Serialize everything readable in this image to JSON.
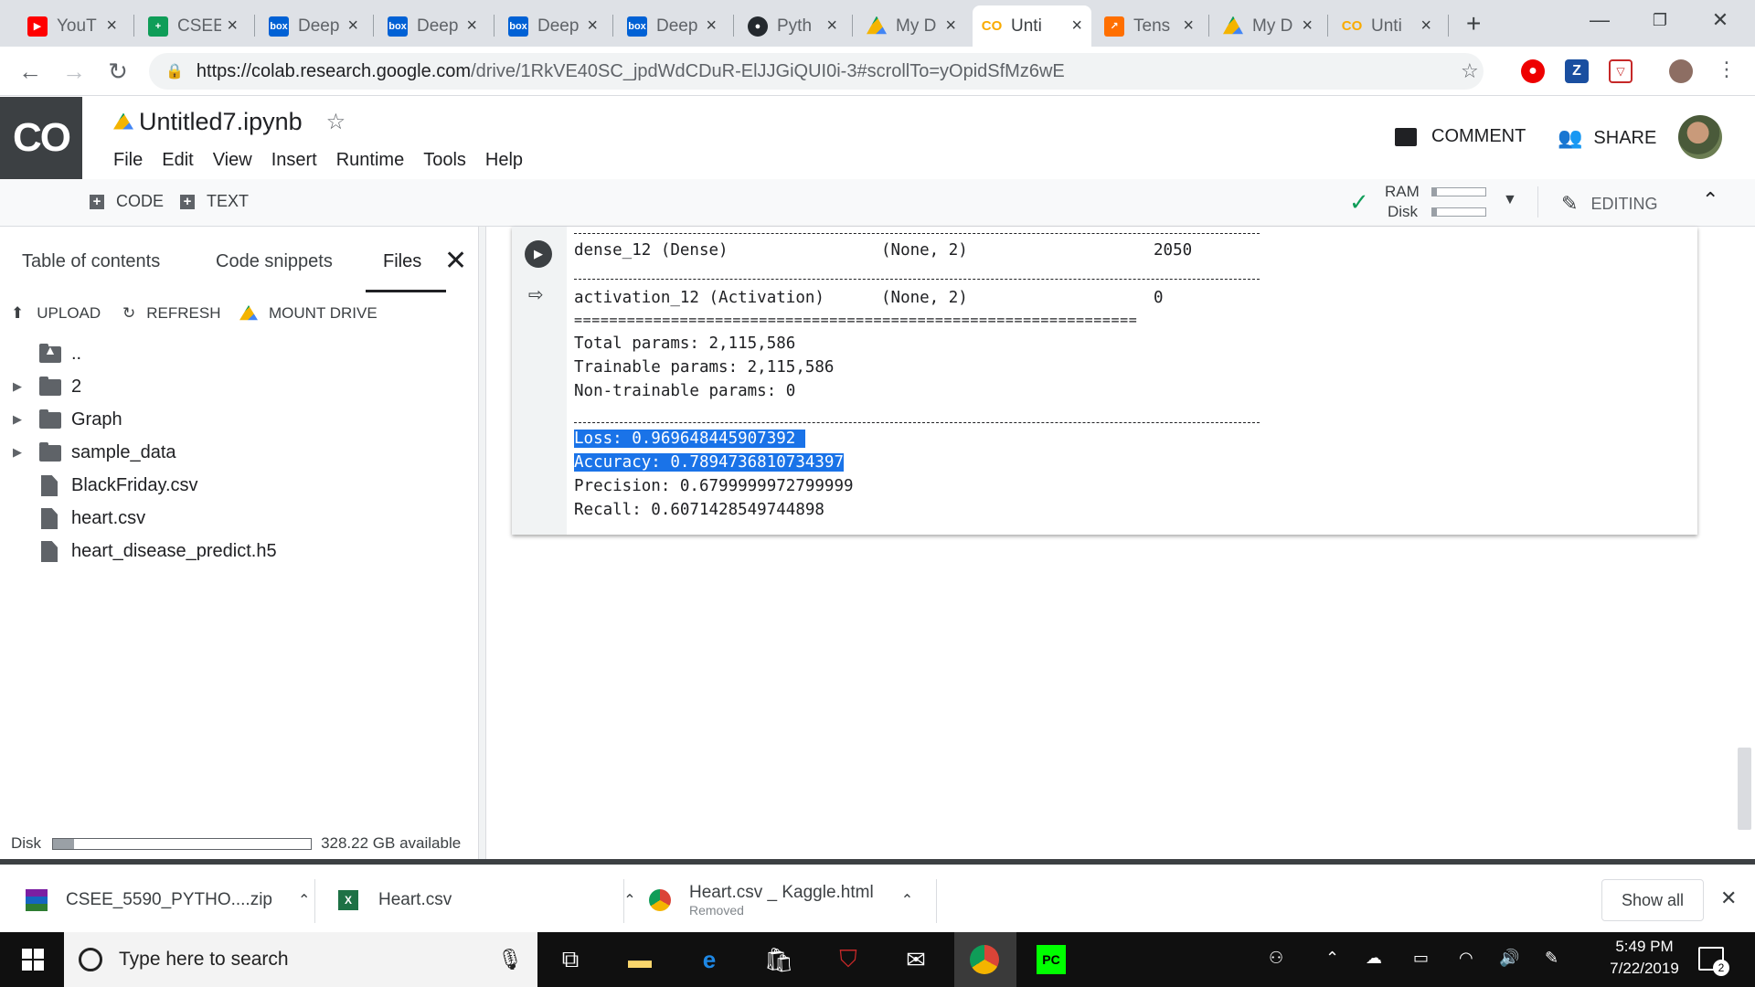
{
  "browser": {
    "tabs": [
      {
        "title": "YouT",
        "favicon": "youtube-icon",
        "color": "#ff0000"
      },
      {
        "title": "CSEE",
        "favicon": "sheets-icon",
        "color": "#0f9d58"
      },
      {
        "title": "Deep",
        "favicon": "box-icon",
        "color": "#0061d5"
      },
      {
        "title": "Deep",
        "favicon": "box-icon",
        "color": "#0061d5"
      },
      {
        "title": "Deep",
        "favicon": "box-icon",
        "color": "#0061d5"
      },
      {
        "title": "Deep",
        "favicon": "box-icon",
        "color": "#0061d5"
      },
      {
        "title": "Pyth",
        "favicon": "github-icon",
        "color": "#24292e"
      },
      {
        "title": "My D",
        "favicon": "drive-icon",
        "color": "#1fa463"
      },
      {
        "title": "Unti",
        "favicon": "colab-icon",
        "color": "#f9ab00",
        "active": true
      },
      {
        "title": "Tens",
        "favicon": "tensorboard-icon",
        "color": "#ff6f00"
      },
      {
        "title": "My D",
        "favicon": "drive-icon",
        "color": "#1fa463"
      },
      {
        "title": "Unti",
        "favicon": "colab-icon",
        "color": "#f9ab00"
      }
    ],
    "new_tab": "+",
    "url_host": "https://colab.research.google.com",
    "url_rest": "/drive/1RkVE40SC_jpdWdCDuR-ElJJGiQUI0i-3#scrollTo=yOpidSfMz6wE"
  },
  "colab": {
    "logo": "CO",
    "notebook_title": "Untitled7.ipynb",
    "menus": [
      "File",
      "Edit",
      "View",
      "Insert",
      "Runtime",
      "Tools",
      "Help"
    ],
    "comment_label": "COMMENT",
    "share_label": "SHARE",
    "code_label": "CODE",
    "text_label": "TEXT",
    "ram_label": "RAM",
    "disk_label": "Disk",
    "editing_label": "EDITING"
  },
  "sidebar": {
    "tabs": [
      "Table of contents",
      "Code snippets",
      "Files"
    ],
    "active_tab": "Files",
    "actions": {
      "upload": "UPLOAD",
      "refresh": "REFRESH",
      "mount": "MOUNT DRIVE"
    },
    "files": [
      {
        "name": "..",
        "type": "parent"
      },
      {
        "name": "2",
        "type": "folder"
      },
      {
        "name": "Graph",
        "type": "folder"
      },
      {
        "name": "sample_data",
        "type": "folder"
      },
      {
        "name": "BlackFriday.csv",
        "type": "file"
      },
      {
        "name": "heart.csv",
        "type": "file"
      },
      {
        "name": "heart_disease_predict.h5",
        "type": "file"
      }
    ],
    "disk_label": "Disk",
    "disk_available": "328.22 GB available"
  },
  "output": {
    "dense_row": {
      "layer": "dense_12 (Dense)",
      "shape": "(None, 2)",
      "params": "2050"
    },
    "activation_row": {
      "layer": "activation_12 (Activation)",
      "shape": "(None, 2)",
      "params": "0"
    },
    "total_params": "Total params: 2,115,586",
    "trainable_params": "Trainable params: 2,115,586",
    "non_trainable_params": "Non-trainable params: 0",
    "loss": "Loss: 0.969648445907392",
    "accuracy": "Accuracy: 0.7894736810734397",
    "precision": "Precision: 0.6799999972799999",
    "recall": "Recall: 0.6071428549744898",
    "double_rule": "================================================================"
  },
  "downloads": {
    "items": [
      {
        "name": "CSEE_5590_PYTHO....zip",
        "status": ""
      },
      {
        "name": "Heart.csv",
        "status": ""
      },
      {
        "name": "Heart.csv _ Kaggle.html",
        "status": "Removed"
      }
    ],
    "show_all": "Show all"
  },
  "taskbar": {
    "search_placeholder": "Type here to search",
    "time": "5:49 PM",
    "date": "7/22/2019",
    "notifications": "2"
  }
}
